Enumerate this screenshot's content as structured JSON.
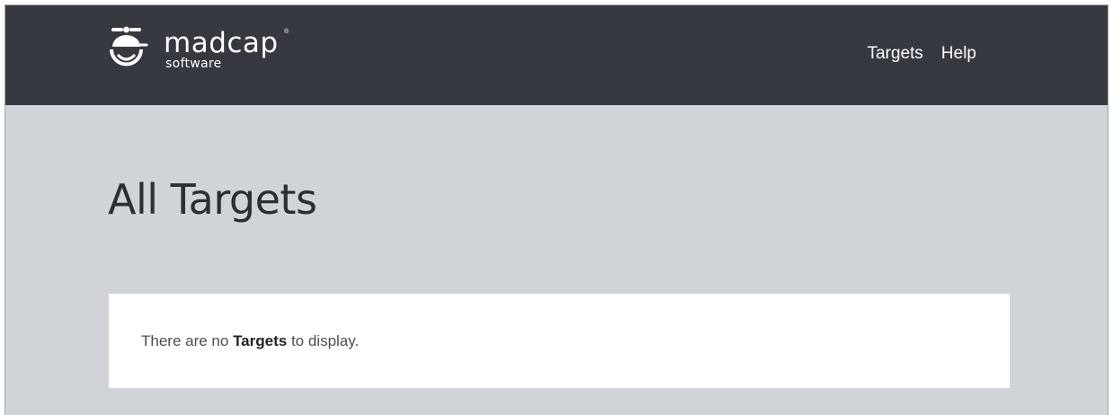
{
  "header": {
    "brand": {
      "name": "madcap",
      "registered": "®",
      "sub": "software",
      "icon": "madcap-propeller-cap-logo-icon"
    },
    "nav": [
      {
        "label": "Targets"
      },
      {
        "label": "Help"
      }
    ]
  },
  "main": {
    "title": "All Targets",
    "empty_message": {
      "before": "There are no ",
      "emphasis": "Targets",
      "after": " to display."
    }
  },
  "colors": {
    "header_bg": "#363a40",
    "page_bg": "#d0d3d7",
    "card_bg": "#ffffff",
    "title_text": "#2b2e33"
  }
}
